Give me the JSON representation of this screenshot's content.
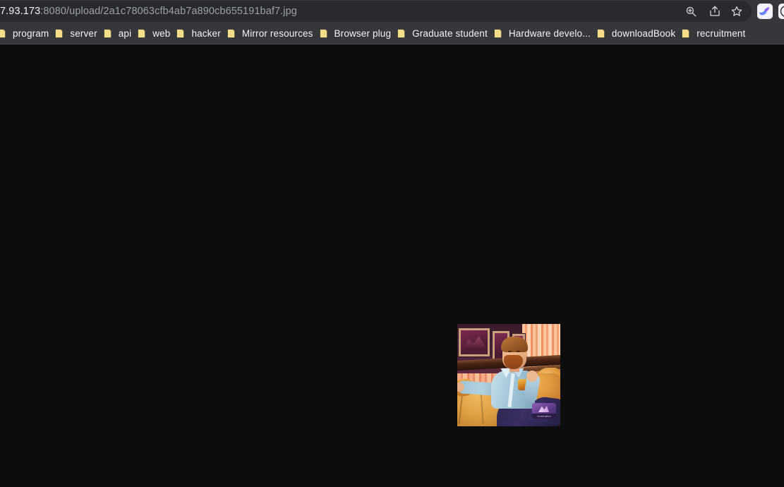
{
  "browser": {
    "omnibox": {
      "host_visible": "7.93.173",
      "path": ":8080/upload/2a1c78063cfb4ab7a890cb655191baf7.jpg",
      "full_visible_url": "7.93.173:8080/upload/2a1c78063cfb4ab7a890cb655191baf7.jpg"
    },
    "omnibox_icons": [
      {
        "name": "zoom-icon"
      },
      {
        "name": "share-icon"
      },
      {
        "name": "bookmark-star-icon"
      }
    ],
    "extensions": [
      {
        "name": "bird-extension-icon"
      },
      {
        "name": "partial-extension-icon"
      }
    ],
    "bookmarks": [
      {
        "label": "program"
      },
      {
        "label": "server"
      },
      {
        "label": "api"
      },
      {
        "label": "web"
      },
      {
        "label": "hacker"
      },
      {
        "label": "Mirror resources"
      },
      {
        "label": "Browser plug"
      },
      {
        "label": "Graduate student"
      },
      {
        "label": "Hardware develo..."
      },
      {
        "label": "downloadBook"
      },
      {
        "label": "recruitment"
      }
    ],
    "colors": {
      "chrome_bg": "#35373b",
      "omnibox_bg": "#292a2d",
      "url_host_text": "#f1f1f3",
      "url_path_text": "#9aa0a6",
      "bookmark_text": "#f3f3f4",
      "folder_icon": "#f5dd8a",
      "page_bg": "#0d0d0d"
    }
  },
  "page": {
    "content_type": "standalone-image",
    "background": "#0d0d0d",
    "image": {
      "alt": "Illustration of a bearded man in a light blue shirt reclining on an orange couch, framed pictures and warm striped wall behind him",
      "natural_width": 146,
      "natural_height": 145,
      "watermark_text": "illustration"
    }
  }
}
